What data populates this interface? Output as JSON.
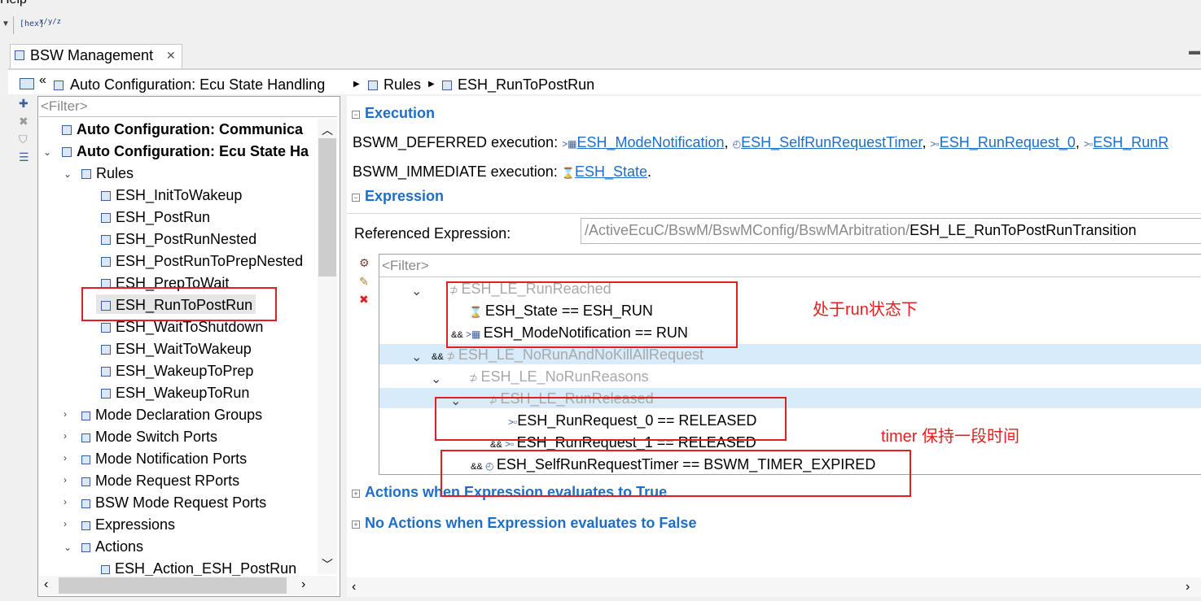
{
  "menu": {
    "help_label": "Help"
  },
  "toolbar": {
    "hex_label": "[hex]",
    "format_label": "x/y/z"
  },
  "editor_tab": {
    "title": "BSW Management"
  },
  "breadcrumb": {
    "item1": "Auto Configuration: Ecu State Handling",
    "item2": "Rules",
    "item3": "ESH_RunToPostRun"
  },
  "left_tree": {
    "filter_placeholder": "<Filter>",
    "items": [
      {
        "label": "Auto Configuration: Communica"
      },
      {
        "label": "Auto Configuration: Ecu State Ha"
      },
      {
        "label": "Rules"
      },
      {
        "label": "ESH_InitToWakeup"
      },
      {
        "label": "ESH_PostRun"
      },
      {
        "label": "ESH_PostRunNested"
      },
      {
        "label": "ESH_PostRunToPrepNested"
      },
      {
        "label": "ESH_PrepToWait"
      },
      {
        "label": "ESH_RunToPostRun"
      },
      {
        "label": "ESH_WaitToShutdown"
      },
      {
        "label": "ESH_WaitToWakeup"
      },
      {
        "label": "ESH_WakeupToPrep"
      },
      {
        "label": "ESH_WakeupToRun"
      },
      {
        "label": "Mode Declaration Groups"
      },
      {
        "label": "Mode Switch Ports"
      },
      {
        "label": "Mode Notification Ports"
      },
      {
        "label": "Mode Request RPorts"
      },
      {
        "label": "BSW Mode Request Ports"
      },
      {
        "label": "Expressions"
      },
      {
        "label": "Actions"
      },
      {
        "label": "ESH_Action_ESH_PostRun"
      }
    ]
  },
  "execution": {
    "title": "Execution",
    "deferred_label": "BSWM_DEFERRED execution:",
    "deferred_links": [
      "ESH_ModeNotification",
      "ESH_SelfRunRequestTimer",
      "ESH_RunRequest_0",
      "ESH_RunR"
    ],
    "immediate_label": "BSWM_IMMEDIATE execution:",
    "immediate_link": "ESH_State",
    "comma": ",",
    "period": "."
  },
  "expression": {
    "title": "Expression",
    "ref_label": "Referenced Expression:",
    "ref_path_gray": "/ActiveEcuC/BswM/BswMConfig/BswMArbitration/",
    "ref_path_name": "ESH_LE_RunToPostRunTransition",
    "filter_placeholder": "<Filter>",
    "tree": [
      {
        "label": "ESH_LE_RunReached"
      },
      {
        "label": "ESH_State == ESH_RUN"
      },
      {
        "label": "ESH_ModeNotification == RUN",
        "op": "&&"
      },
      {
        "label": "ESH_LE_NoRunAndNoKillAllRequest",
        "op": "&&"
      },
      {
        "label": "ESH_LE_NoRunReasons"
      },
      {
        "label": "ESH_LE_RunReleased"
      },
      {
        "label": "ESH_RunRequest_0 == RELEASED"
      },
      {
        "label": "ESH_RunRequest_1 == RELEASED",
        "op": "&&"
      },
      {
        "label": "ESH_SelfRunRequestTimer == BSWM_TIMER_EXPIRED",
        "op": "&&"
      }
    ]
  },
  "sections": {
    "actions_true": "Actions when Expression evaluates to True",
    "actions_false": "No Actions when Expression evaluates to False"
  },
  "annotations": {
    "note1": "处于run状态下",
    "note2": "timer 保持一段时间",
    "highlight_color": "#e02020"
  }
}
